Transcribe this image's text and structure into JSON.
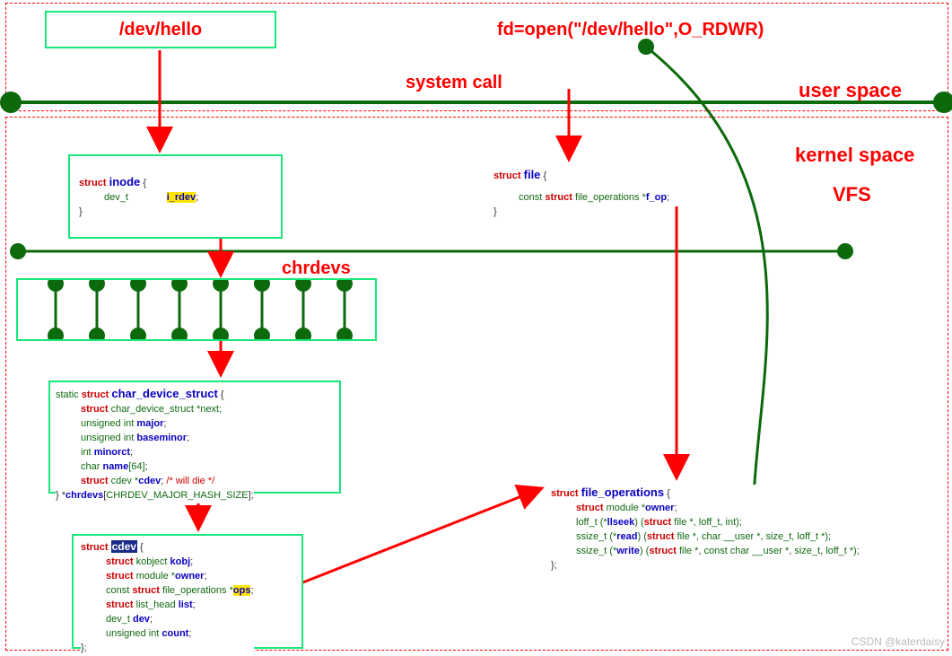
{
  "labels": {
    "dev_hello": "/dev/hello",
    "fd_open": "fd=open(\"/dev/hello\",O_RDWR)",
    "system_call": "system call",
    "user_space": "user space",
    "kernel_space": "kernel space",
    "vfs": "VFS",
    "chrdevs": "chrdevs"
  },
  "code": {
    "inode": {
      "l1_kw": "struct ",
      "l1_name": "inode",
      "l1_brace": " {",
      "l2_ty": "dev_t ",
      "l2_field": "i_rdev",
      "l2_end": ";",
      "l3": "}"
    },
    "file": {
      "l1_kw": "struct ",
      "l1_name": "file",
      "l1_brace": " {",
      "l2_pre": "const ",
      "l2_kw": "struct",
      "l2_ty": " file_operations  *",
      "l2_field": "f_op",
      "l2_end": ";",
      "l3": "}"
    },
    "char_device_struct": {
      "l1_static": "static ",
      "l1_struct": "struct ",
      "l1_name": "char_device_struct",
      "l1_brace": " {",
      "l2_kw": "struct",
      "l2_rest": " char_device_struct *next;",
      "l3_pre": "unsigned int ",
      "l3_field": "major",
      "l3_end": ";",
      "l4_pre": "unsigned int ",
      "l4_field": "baseminor",
      "l4_end": ";",
      "l5_pre": "int ",
      "l5_field": "minorct",
      "l5_end": ";",
      "l6_pre": "char ",
      "l6_field": "name",
      "l6_arr": "[64]",
      "l6_end": ";",
      "l7_kw": "struct",
      "l7_ty": " cdev *",
      "l7_field": "cdev",
      "l7_end": ";",
      "l7_comment": "          /* will die */",
      "l8_a": "} *",
      "l8_field": "chrdevs",
      "l8_b": "[",
      "l8_c": "CHRDEV_MAJOR_HASH_SIZE",
      "l8_d": "];"
    },
    "cdev": {
      "l1_kw": "struct ",
      "l1_name": "cdev",
      "l1_brace": " {",
      "l2_kw": "struct",
      "l2_ty": " kobject ",
      "l2_field": "kobj",
      "l2_end": ";",
      "l3_kw": "struct",
      "l3_ty": " module *",
      "l3_field": "owner",
      "l3_end": ";",
      "l4_pre": "const ",
      "l4_kw": "struct",
      "l4_ty": " file_operations *",
      "l4_field": "ops",
      "l4_end": ";",
      "l5_kw": "struct",
      "l5_ty": " list_head ",
      "l5_field": "list",
      "l5_end": ";",
      "l6_ty": "dev_t ",
      "l6_field": "dev",
      "l6_end": ";",
      "l7_pre": "unsigned int ",
      "l7_field": "count",
      "l7_end": ";",
      "l8": "};"
    },
    "fops": {
      "l1_kw": "struct ",
      "l1_name": "file_operations",
      "l1_brace": " {",
      "l2_kw": "struct",
      "l2_ty": " module *",
      "l2_field": "owner",
      "l2_end": ";",
      "l3_a": "loff_t (*",
      "l3_field": "llseek",
      "l3_b": ") (",
      "l3_kw": "struct",
      "l3_c": " file *, loff_t, int);",
      "l4_a": "ssize_t (*",
      "l4_field": "read",
      "l4_b": ") (",
      "l4_kw": "struct",
      "l4_c": " file *, char __user *, size_t, loff_t *);",
      "l5_a": "ssize_t (*",
      "l5_field": "write",
      "l5_b": ") (",
      "l5_kw": "struct",
      "l5_c": " file *, const char __user *, size_t, loff_t *);",
      "l6": "};"
    }
  },
  "watermark": "CSDN @katerdaisy"
}
